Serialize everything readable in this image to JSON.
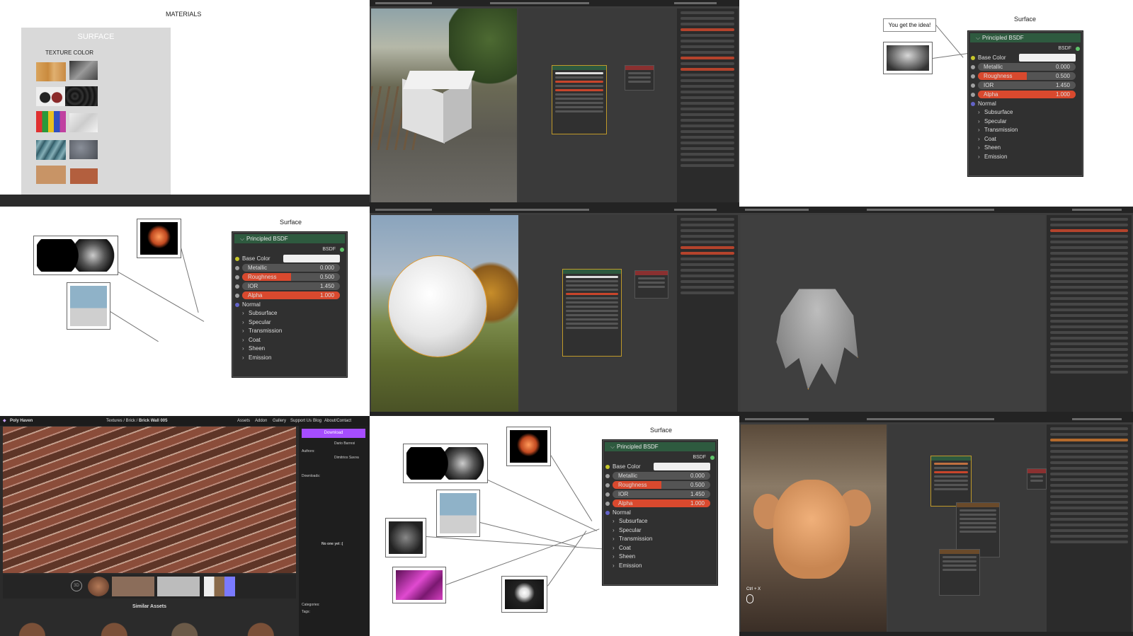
{
  "panel1": {
    "title": "MATERIALS",
    "card_title": "SURFACE",
    "card_subtitle": "TEXTURE COLOR"
  },
  "panel3": {
    "title": "Surface",
    "callout": "You get the idea!"
  },
  "panel4": {
    "title": "Surface"
  },
  "panel8": {
    "title": "Surface"
  },
  "principled": {
    "header": "Principled BSDF",
    "output": "BSDF",
    "base_color": "Base Color",
    "metallic_label": "Metallic",
    "metallic_value": "0.000",
    "roughness_label": "Roughness",
    "roughness_value": "0.500",
    "roughness_fill": 0.5,
    "ior_label": "IOR",
    "ior_value": "1.450",
    "alpha_label": "Alpha",
    "alpha_value": "1.000",
    "normal": "Normal",
    "subpanels": [
      "Subsurface",
      "Specular",
      "Transmission",
      "Coat",
      "Sheen",
      "Emission"
    ]
  },
  "polyhaven": {
    "brand": "Poly Haven",
    "breadcrumb_prefix": "Textures / Brick / ",
    "breadcrumb_current": "Brick Wall 005",
    "nav": [
      "Assets",
      "Addon",
      "Gallery",
      "Support Us",
      "Blog",
      "About/Contact"
    ],
    "download": "Download",
    "authors_label": "Authors:",
    "author1": "Dario Barresi",
    "author2": "Dimitrios Savva",
    "downloads_label": "Downloads:",
    "sponsored": "No one yet :(",
    "similar": "Similar Assets",
    "categories_label": "Categories:",
    "tags_label": "Tags:"
  },
  "shortcut_hint": "Ctrl + X",
  "colors": {
    "node_header": "#2e5a3f",
    "accent_red": "#d9492e",
    "socket_yellow": "#c7c729",
    "socket_green": "#5fc36a",
    "socket_violet": "#6363c7",
    "polyhaven_purple": "#a64dff"
  }
}
